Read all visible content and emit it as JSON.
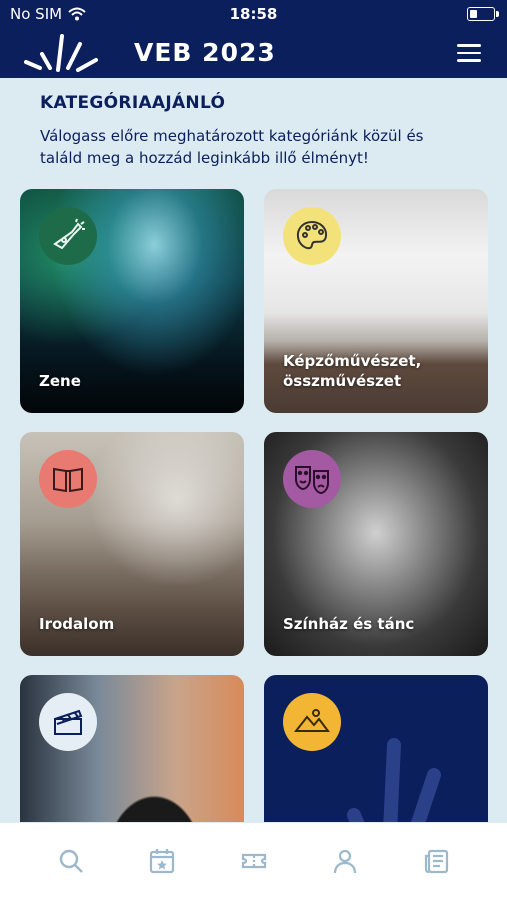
{
  "status_bar": {
    "carrier": "No SIM",
    "time": "18:58"
  },
  "header": {
    "title": "VEB 2023"
  },
  "section": {
    "title": "KATEGÓRIAAJÁNLÓ",
    "description": "Válogass előre meghatározott kategóriánk közül és találd meg a hozzád leginkább illő élményt!"
  },
  "categories": [
    {
      "label": "Zene",
      "icon": "trumpet-icon",
      "color": "#1e6b4a"
    },
    {
      "label": "Képzőművészet, összművészet",
      "icon": "palette-icon",
      "color": "#f3e27a"
    },
    {
      "label": "Irodalom",
      "icon": "book-icon",
      "color": "#e87a72"
    },
    {
      "label": "Színház és tánc",
      "icon": "theater-masks-icon",
      "color": "#a45aa3"
    },
    {
      "label": "",
      "icon": "clapperboard-icon",
      "color": "#e6eef5"
    },
    {
      "label": "",
      "icon": "mountains-icon",
      "color": "#f2b634"
    }
  ],
  "tabbar": [
    "search-icon",
    "calendar-star-icon",
    "ticket-icon",
    "profile-icon",
    "news-icon"
  ]
}
